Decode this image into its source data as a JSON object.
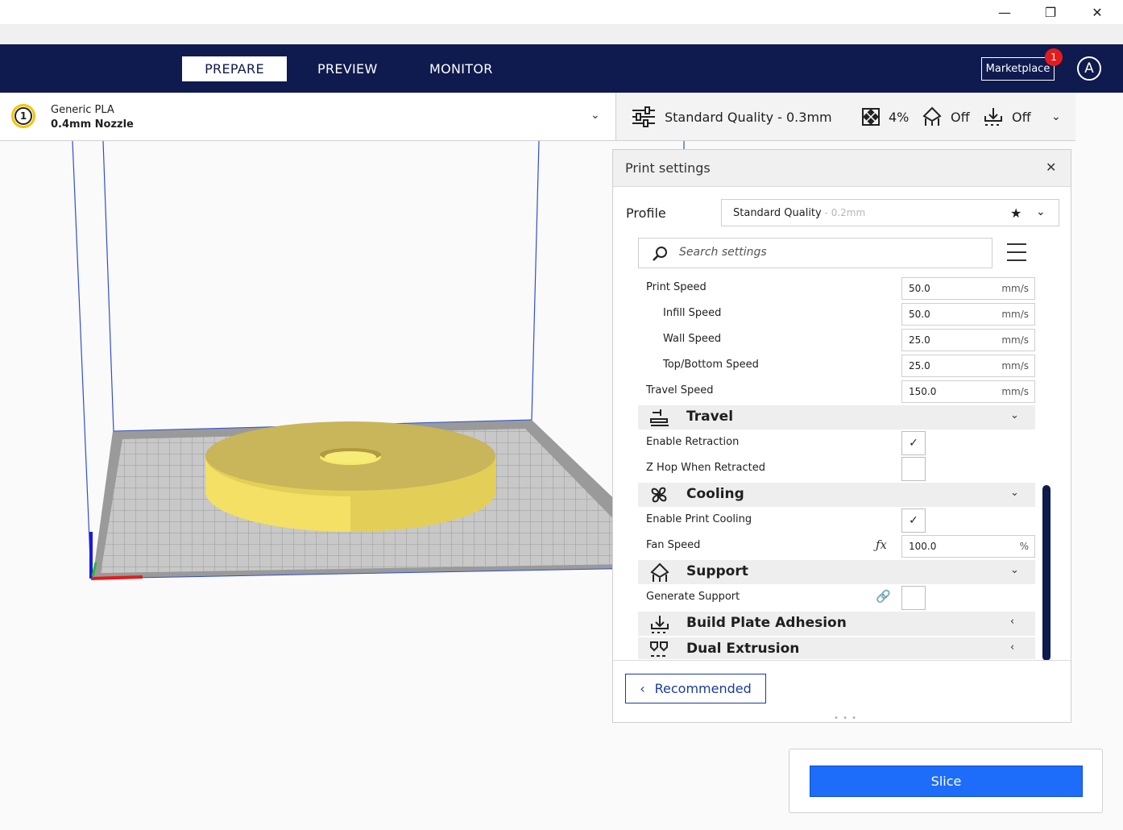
{
  "window": {
    "minimize_glyph": "—",
    "restore_glyph": "❐",
    "close_glyph": "✕"
  },
  "nav": {
    "tabs": [
      {
        "label": "PREPARE",
        "active": true
      },
      {
        "label": "PREVIEW",
        "active": false
      },
      {
        "label": "MONITOR",
        "active": false
      }
    ],
    "marketplace_label": "Marketplace",
    "marketplace_badge": "1",
    "account_initial": "A"
  },
  "material": {
    "extruder_number": "1",
    "name": "Generic PLA",
    "nozzle": "0.4mm Nozzle"
  },
  "quality_bar": {
    "quality": "Standard Quality - 0.3mm",
    "infill": "4%",
    "support": "Off",
    "adhesion": "Off"
  },
  "print_settings": {
    "title": "Print settings",
    "profile_label": "Profile",
    "profile_name": "Standard Quality",
    "profile_suffix": " - 0.2mm",
    "search_placeholder": "Search settings",
    "rows": {
      "print_speed": {
        "label": "Print Speed",
        "value": "50.0",
        "unit": "mm/s"
      },
      "infill_speed": {
        "label": "Infill Speed",
        "value": "50.0",
        "unit": "mm/s"
      },
      "wall_speed": {
        "label": "Wall Speed",
        "value": "25.0",
        "unit": "mm/s"
      },
      "topbottom_speed": {
        "label": "Top/Bottom Speed",
        "value": "25.0",
        "unit": "mm/s"
      },
      "travel_speed": {
        "label": "Travel Speed",
        "value": "150.0",
        "unit": "mm/s"
      },
      "enable_retraction": {
        "label": "Enable Retraction",
        "checked": true
      },
      "z_hop": {
        "label": "Z Hop When Retracted",
        "checked": false
      },
      "enable_cooling": {
        "label": "Enable Print Cooling",
        "checked": true
      },
      "fan_speed": {
        "label": "Fan Speed",
        "value": "100.0",
        "unit": "%"
      },
      "generate_support": {
        "label": "Generate Support",
        "checked": false
      }
    },
    "sections": {
      "travel": "Travel",
      "cooling": "Cooling",
      "support": "Support",
      "adhesion": "Build Plate Adhesion",
      "dual": "Dual Extrusion"
    },
    "check_glyph": "✓",
    "recommended_label": "Recommended"
  },
  "slice": {
    "label": "Slice"
  },
  "colors": {
    "header": "#0f1a4e",
    "accent": "#1d6dfa",
    "model": "#f5e47a",
    "badge": "#e21c1c"
  }
}
